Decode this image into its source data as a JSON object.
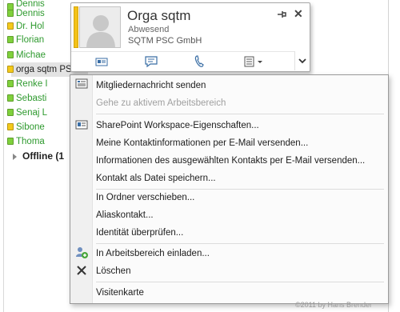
{
  "contacts": [
    {
      "name": "Dennis",
      "color": "#2f9a2f",
      "status_color": "#7fd13b"
    },
    {
      "name": "Dr. Hol",
      "color": "#2f9a2f",
      "status_color": "#f4c91a"
    },
    {
      "name": "Florian",
      "color": "#2f9a2f",
      "status_color": "#7fd13b"
    },
    {
      "name": "Michae",
      "color": "#2f9a2f",
      "status_color": "#7fd13b"
    },
    {
      "name": "orga sqtm PSC GmbH",
      "color": "#1e1e1e",
      "status_color": "#f4c91a",
      "selected": true
    },
    {
      "name": "Renke I",
      "color": "#2f9a2f",
      "status_color": "#7fd13b"
    },
    {
      "name": "Sebasti",
      "color": "#2f9a2f",
      "status_color": "#7fd13b"
    },
    {
      "name": "Senaj L",
      "color": "#2f9a2f",
      "status_color": "#7fd13b"
    },
    {
      "name": "Sibone",
      "color": "#2f9a2f",
      "status_color": "#f4c91a"
    },
    {
      "name": "Thoma",
      "color": "#2f9a2f",
      "status_color": "#7fd13b"
    }
  ],
  "offline_group": "Offline (1",
  "card": {
    "name": "Orga sqtm",
    "status": "Abwesend",
    "company": "SQTM PSC GmbH"
  },
  "menu": {
    "items": [
      {
        "label": "Mitgliedernachricht senden",
        "disabled": false,
        "icon": "member-message-icon"
      },
      {
        "label": "Gehe zu aktivem Arbeitsbereich",
        "disabled": true
      },
      {
        "label": "SharePoint Workspace-Eigenschaften...",
        "disabled": false,
        "icon": "properties-card-icon"
      },
      {
        "label": "Meine Kontaktinformationen per E-Mail versenden...",
        "disabled": false
      },
      {
        "label": "Informationen des ausgewählten Kontakts per E-Mail versenden...",
        "disabled": false
      },
      {
        "label": "Kontakt als Datei speichern...",
        "disabled": false
      },
      {
        "label": "In Ordner verschieben...",
        "disabled": false
      },
      {
        "label": "Aliaskontakt...",
        "disabled": false
      },
      {
        "label": "Identität überprüfen...",
        "disabled": false
      },
      {
        "label": "In Arbeitsbereich einladen...",
        "disabled": false,
        "icon": "invite-users-icon"
      },
      {
        "label": "Löschen",
        "disabled": false,
        "icon": "delete-x-icon"
      },
      {
        "label": "Visitenkarte",
        "disabled": false
      }
    ]
  },
  "copyright": "©2011 by Hans Brender",
  "colors": {
    "away": "#f4c91a",
    "online": "#7fd13b"
  }
}
